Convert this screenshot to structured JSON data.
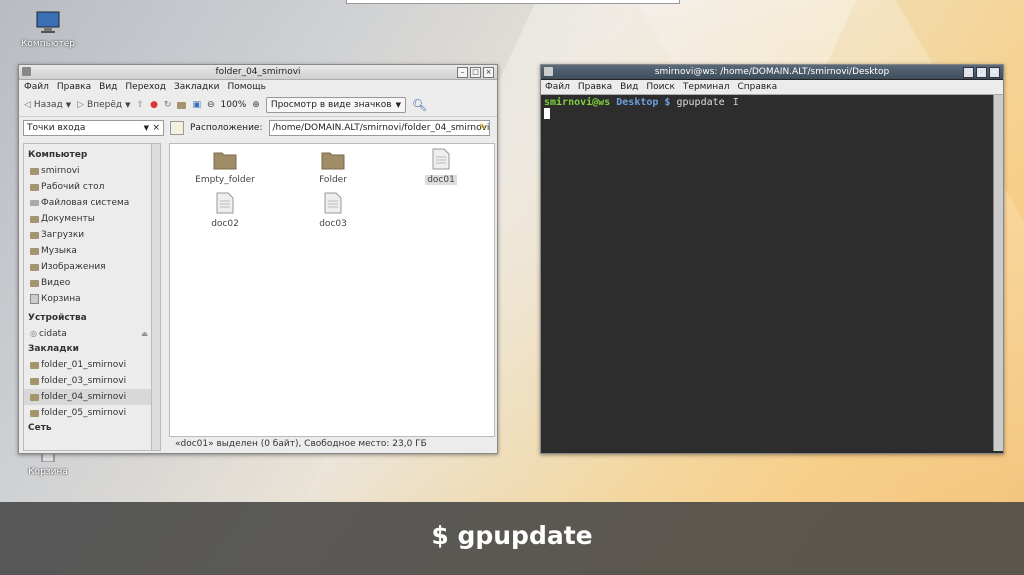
{
  "desktop": {
    "icons": [
      {
        "label": "Компьютер"
      },
      {
        "label": "Корзина"
      }
    ]
  },
  "file_manager": {
    "title": "folder_04_smirnovi",
    "menu": [
      "Файл",
      "Правка",
      "Вид",
      "Переход",
      "Закладки",
      "Помощь"
    ],
    "toolbar": {
      "back": "Назад",
      "forward": "Вперёд",
      "zoom": "100%",
      "view_mode": "Просмотр в виде значков"
    },
    "places_select": "Точки входа",
    "location_label": "Расположение:",
    "location_value": "/home/DOMAIN.ALT/smirnovi/folder_04_smirnovi",
    "sidebar": {
      "computer_heading": "Компьютер",
      "computer_items": [
        "smirnovi",
        "Рабочий стол",
        "Файловая система",
        "Документы",
        "Загрузки",
        "Музыка",
        "Изображения",
        "Видео",
        "Корзина"
      ],
      "devices_heading": "Устройства",
      "device_items": [
        "cidata"
      ],
      "bookmarks_heading": "Закладки",
      "bookmark_items": [
        "folder_01_smirnovi",
        "folder_03_smirnovi",
        "folder_04_smirnovi",
        "folder_05_smirnovi"
      ],
      "network_heading": "Сеть"
    },
    "files": [
      {
        "name": "Empty_folder",
        "type": "folder"
      },
      {
        "name": "Folder",
        "type": "folder"
      },
      {
        "name": "doc01",
        "type": "file",
        "selected": true
      },
      {
        "name": "doc02",
        "type": "file"
      },
      {
        "name": "doc03",
        "type": "file"
      }
    ],
    "status": "«doc01» выделен (0 байт), Свободное место: 23,0 ГБ"
  },
  "terminal": {
    "title": "smirnovi@ws: /home/DOMAIN.ALT/smirnovi/Desktop",
    "menu": [
      "Файл",
      "Правка",
      "Вид",
      "Поиск",
      "Терминал",
      "Справка"
    ],
    "prompt_user": "smirnovi@ws",
    "prompt_path": "Desktop $",
    "command": "gpupdate"
  },
  "caption": "$ gpupdate"
}
